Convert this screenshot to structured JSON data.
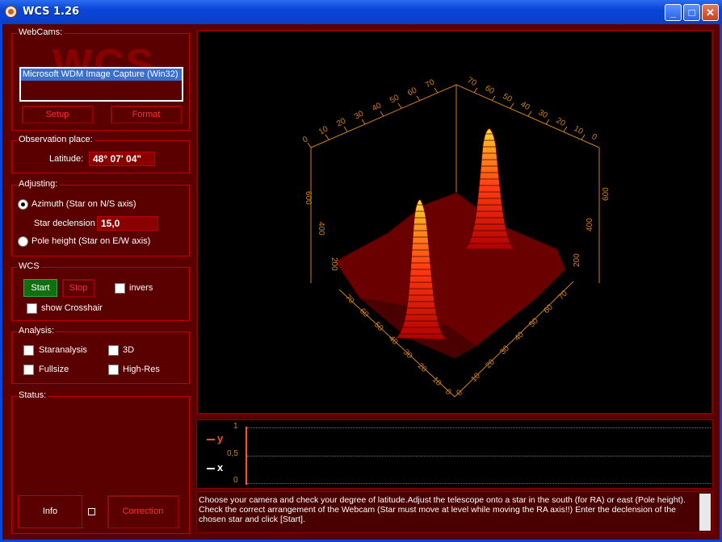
{
  "window": {
    "title": "WCS 1.26"
  },
  "webcams": {
    "legend": "WebCams:",
    "watermark": "WCS",
    "device": "Microsoft WDM Image Capture (Win32)",
    "setup_label": "Setup",
    "format_label": "Format"
  },
  "observation": {
    "legend": "Observation place:",
    "latitude_label": "Latitude:",
    "latitude_value": "48° 07' 04\""
  },
  "adjusting": {
    "legend": "Adjusting:",
    "azimuth_label": "Azimuth (Star on N/S axis)",
    "declension_label": "Star declension",
    "declension_value": "15,0",
    "pole_label": "Pole height (Star on E/W axis)",
    "selected": "azimuth"
  },
  "wcs": {
    "legend": "WCS",
    "start_label": "Start",
    "stop_label": "Stop",
    "invers_label": "invers",
    "crosshair_label": "show Crosshair"
  },
  "analysis": {
    "legend": "Analysis:",
    "staranalysis_label": "Staranalysis",
    "threed_label": "3D",
    "fullsize_label": "Fullsize",
    "highres_label": "High-Res"
  },
  "status": {
    "legend": "Status:",
    "info_label": "Info",
    "correction_label": "Correction"
  },
  "graph": {
    "y_legend": "y",
    "x_legend": "x",
    "ticks": [
      "1",
      "0,5",
      "0"
    ]
  },
  "plot": {
    "axis_left_ticks": [
      "0",
      "10",
      "20",
      "30",
      "40",
      "50",
      "60",
      "70"
    ],
    "axis_right_ticks": [
      "70",
      "60",
      "50",
      "40",
      "30",
      "20",
      "10",
      "0"
    ],
    "side_ticks": [
      "600",
      "400",
      "200"
    ],
    "front_left_ticks": [
      "70",
      "60",
      "50",
      "40",
      "30",
      "20",
      "10",
      "0"
    ],
    "front_right_ticks": [
      "0",
      "10",
      "20",
      "30",
      "40",
      "50",
      "60",
      "70"
    ]
  },
  "message": "Choose your camera and check your degree of latitude.Adjust the telescope onto a star in the south (for RA) or east (Pole height). Check the correct arrangement of the Webcam (Star must move at level while moving the RA axis!!) Enter the declension of the chosen star and click [Start].",
  "colors": {
    "accent": "#c00000",
    "panel": "#5a0000",
    "axis": "#d08020"
  }
}
